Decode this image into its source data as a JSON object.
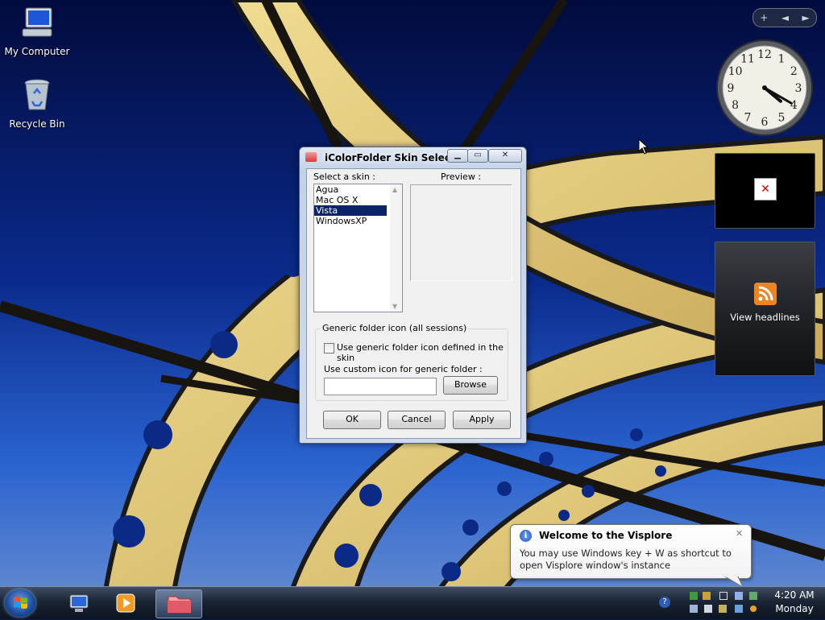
{
  "desktop": {
    "icons": [
      {
        "label": "My Computer"
      },
      {
        "label": "Recycle Bin"
      }
    ]
  },
  "sidebar": {
    "controls": [
      "+",
      "◄",
      "►"
    ],
    "clock": {
      "numerals": [
        "12",
        "1",
        "2",
        "3",
        "4",
        "5",
        "6",
        "7",
        "8",
        "9",
        "10",
        "11"
      ],
      "hour": 4,
      "minute": 20
    },
    "feed_gadget": {
      "label": "View headlines"
    },
    "blank_gadget": {
      "broken_image_glyph": "✕"
    }
  },
  "dialog": {
    "title": "iColorFolder Skin Selector",
    "titlebar_buttons": {
      "minimize": "▁",
      "maximize": "▭",
      "close": "✕"
    },
    "select_skin_label": "Select a skin :",
    "preview_label": "Preview :",
    "skins": [
      "Agua",
      "Mac OS X",
      "Vista",
      "WindowsXP"
    ],
    "selected_skin": "Vista",
    "groupbox_title": "Generic folder icon (all sessions)",
    "checkbox_label": "Use generic folder icon defined in the skin",
    "checkbox_checked": false,
    "custom_icon_label": "Use custom icon for generic folder :",
    "custom_icon_value": "",
    "browse_label": "Browse",
    "ok_label": "OK",
    "cancel_label": "Cancel",
    "apply_label": "Apply"
  },
  "balloon": {
    "title": "Welcome to the Visplore",
    "close_glyph": "✕",
    "text": "You may use Windows key + W as shortcut to open Visplore window's instance"
  },
  "taskbar": {
    "help_glyph": "?",
    "time": "4:20 AM",
    "day": "Monday"
  },
  "colors": {
    "selection": "#0a246a",
    "taskbar": "#1a2433",
    "sky": "#07185a"
  }
}
